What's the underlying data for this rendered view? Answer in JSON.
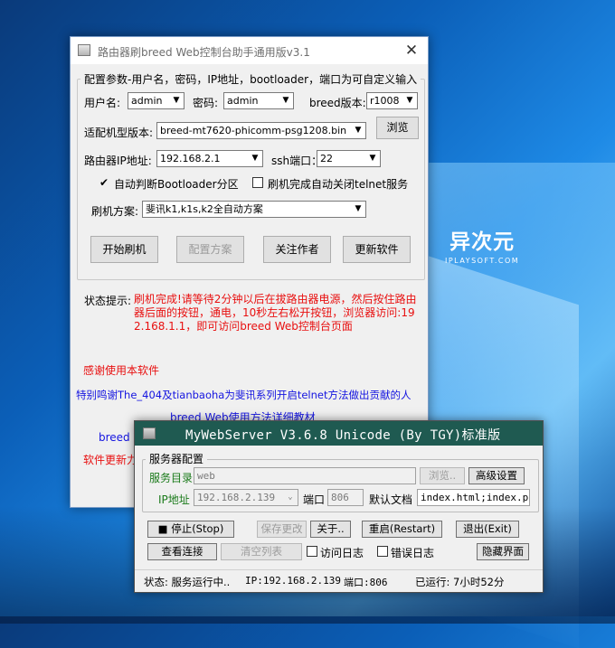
{
  "desktop": {
    "brand_cn": "异次元",
    "brand_en": "IPLAYSOFT.COM"
  },
  "breed_window": {
    "title": "路由器刷breed Web控制台助手通用版v3.1",
    "group_legend": "配置参数-用户名，密码，IP地址，bootloader，端口为可自定义输入",
    "username_label": "用户名:",
    "username_value": "admin",
    "password_label": "密码:",
    "password_value": "admin",
    "breed_version_label": "breed版本:",
    "breed_version_value": "r1008",
    "model_label": "适配机型版本:",
    "model_value": "breed-mt7620-phicomm-psg1208.bin",
    "browse_button": "浏览",
    "ip_label": "路由器IP地址:",
    "ip_value": "192.168.2.1",
    "ssh_port_label": "ssh端口：",
    "ssh_port_value": "22",
    "auto_detect_label": "自动判断Bootloader分区",
    "auto_detect_checked": true,
    "close_telnet_label": "刷机完成自动关闭telnet服务",
    "close_telnet_checked": false,
    "scheme_label": "刷机方案:",
    "scheme_value": "斐讯k1,k1s,k2全自动方案",
    "buttons": {
      "start": "开始刷机",
      "config": "配置方案",
      "follow": "关注作者",
      "update": "更新软件"
    },
    "status_label": "状态提示:",
    "status_text": "刷机完成!请等待2分钟以后在拔路由器电源，然后按住路由器后面的按钮，通电，10秒左右松开按钮，浏览器访问:192.168.1.1，即可访问breed Web控制台页面",
    "thanks": "感谢使用本软件",
    "special_thanks": "特别鸣谢The_404及tianbaoha为斐讯系列开启telnet方法做出贡献的人",
    "tutorial_link": "breed Web使用方法详细教材",
    "partial_link": "breed W",
    "update_partial": "软件更新力"
  },
  "webserver_window": {
    "title": "MyWebServer V3.6.8 Unicode (By TGY)标准版",
    "group_legend": "服务器配置",
    "service_dir_label": "服务目录",
    "service_dir_value": "web",
    "browse_button": "浏览..",
    "advanced_button": "高级设置",
    "ip_label": "IP地址",
    "ip_value": "192.168.2.139",
    "port_label": "端口",
    "port_value": "806",
    "default_doc_label": "默认文档",
    "default_doc_value": "index.html;index.php",
    "buttons": {
      "stop": "■ 停止(Stop)",
      "save": "保存更改",
      "about": "关于..",
      "restart": "重启(Restart)",
      "exit": "退出(Exit)",
      "view_conn": "查看连接",
      "clear_list": "清空列表",
      "hide_ui": "隐藏界面"
    },
    "access_log_label": "访问日志",
    "error_log_label": "错误日志",
    "status": {
      "state": "状态: 服务运行中..",
      "ip": "IP:192.168.2.139",
      "port": "端口:806",
      "uptime": "已运行: 7小时52分"
    }
  }
}
